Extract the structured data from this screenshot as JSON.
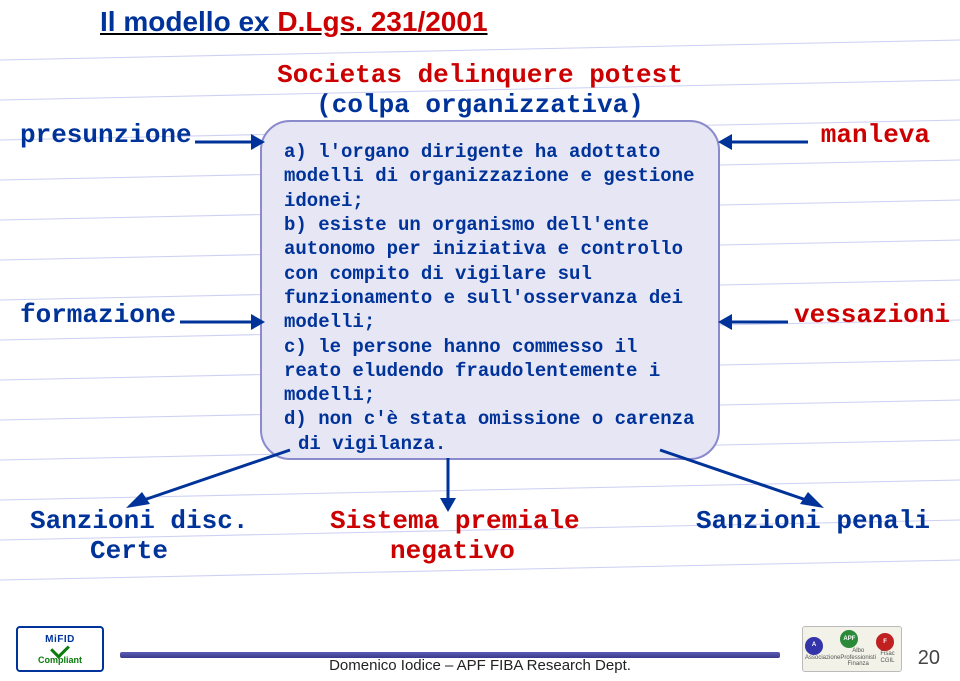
{
  "title_it": "Il modello ex ",
  "title_law": "D.Lgs. 231/2001",
  "subtitle_latin": "Societas delinquere potest",
  "subtitle_paren": "(colpa organizzativa)",
  "box": {
    "a": "a) l'organo dirigente ha adottato modelli di organizzazione e gestione idonei;",
    "b": "b) esiste un organismo dell'ente autonomo per iniziativa e controllo con compito di vigilare sul funzionamento e sull'osservanza dei modelli;",
    "c": "c) le persone hanno commesso il reato eludendo fraudolentemente i modelli;",
    "d": "d) non c'è stata omissione o carenza di vigilanza."
  },
  "labels": {
    "presunzione": "presunzione",
    "formazione": "formazione",
    "manleva": "manleva",
    "vessazioni": "vessazioni",
    "sanz_disc": "Sanzioni disc.",
    "certe": "Certe",
    "sist1": "Sistema premiale",
    "sist2": "negativo",
    "sanz_pen": "Sanzioni penali"
  },
  "footer": {
    "author": "Domenico Iodice – APF FIBA Research Dept.",
    "page": "20"
  },
  "logo_left": {
    "line1": "MiFID",
    "line2": "Compliant"
  },
  "logo_right": {
    "col1": "Associazione",
    "col2a": "Albo",
    "col2b": "Professionisti",
    "col2c": "Finanza",
    "col3": "Fisac CGIL"
  },
  "colors": {
    "blue": "#003399",
    "red": "#cc0000",
    "boxfill": "#e6e6f5",
    "boxborder": "#8a8acc"
  }
}
